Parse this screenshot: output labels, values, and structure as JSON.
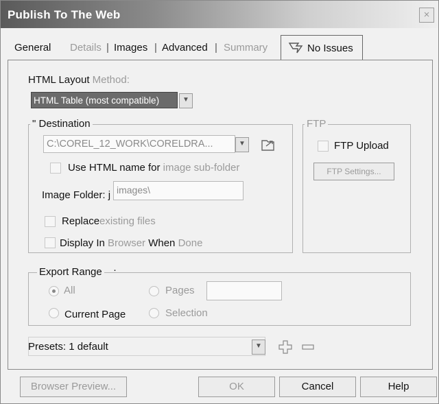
{
  "window": {
    "title": "Publish To The Web",
    "close_glyph": "×"
  },
  "tabs": [
    {
      "label": "General",
      "state": "normal"
    },
    {
      "label": "Details",
      "state": "disabled"
    },
    {
      "label": "Images",
      "state": "normal"
    },
    {
      "label": "Advanced",
      "state": "normal"
    },
    {
      "label": "Summary",
      "state": "disabled"
    },
    {
      "label": "No Issues",
      "state": "active",
      "icon": "issues-icon"
    }
  ],
  "tab_separator": "|",
  "layout": {
    "label_prefix": "HTML Layout",
    "label_suffix": "Method:",
    "value": "HTML Table (most compatible)"
  },
  "destination": {
    "title": "\" Destination",
    "path": "C:\\COREL_12_WORK\\CORELDRA...",
    "use_html_name_prefix": "Use HTML name for",
    "use_html_name_suffix": "image sub-folder",
    "image_folder_label": "Image Folder: j",
    "image_folder_value": "images\\",
    "replace_prefix": "Replace",
    "replace_suffix": "existing files",
    "display_1": "Display In",
    "display_2": "Browser",
    "display_3": "When",
    "display_4": "Done"
  },
  "ftp": {
    "title": "FTP",
    "upload_label": "FTP Upload",
    "settings_label": "FTP Settings..."
  },
  "export_range": {
    "title": "Export Range",
    "all_label": "All",
    "pages_label": "Pages",
    "current_page_label": "Current Page",
    "selection_label": "Selection",
    "selected": "All"
  },
  "presets": {
    "label": "Presets:",
    "value": "1 default"
  },
  "buttons": {
    "browser_preview": "Browser Preview...",
    "ok": "OK",
    "cancel": "Cancel",
    "help": "Help"
  }
}
